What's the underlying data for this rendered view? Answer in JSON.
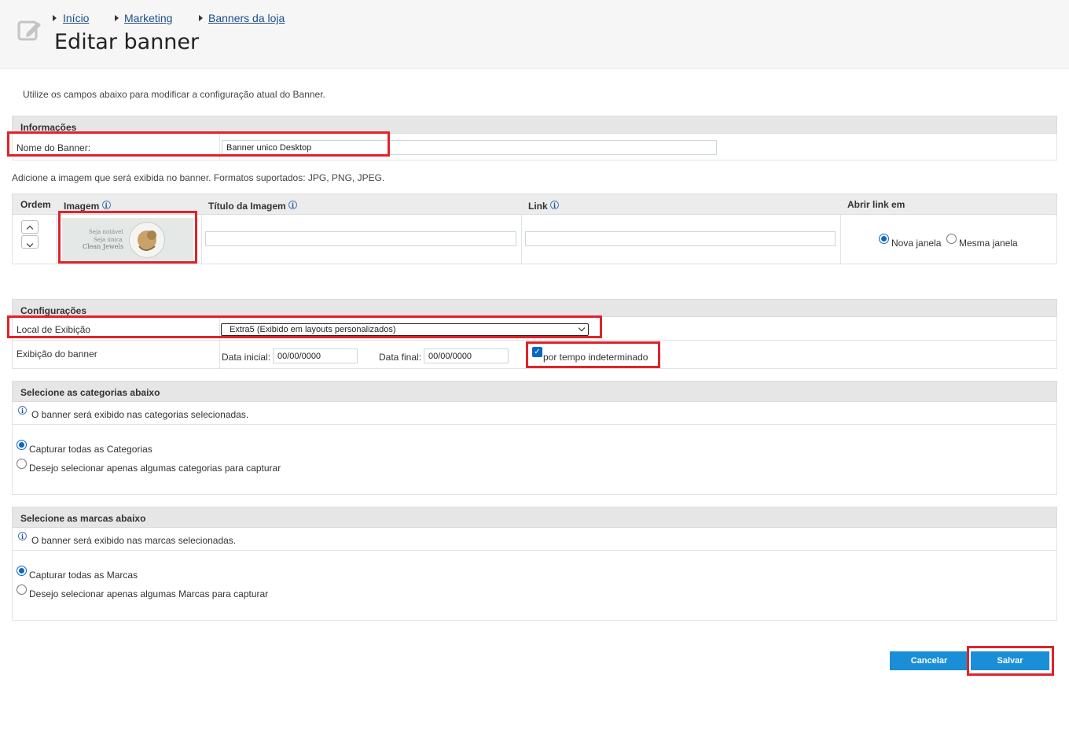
{
  "breadcrumb": [
    "Início",
    "Marketing",
    "Banners da loja"
  ],
  "page_title": "Editar banner",
  "intro": "Utilize os campos abaixo para modificar a configuração atual do Banner.",
  "info_section": {
    "title": "Informações",
    "name_label": "Nome do Banner:",
    "name_value": "Banner unico Desktop"
  },
  "image_hint": "Adicione a imagem que será exibida no banner. Formatos suportados: JPG, PNG, JPEG.",
  "image_table": {
    "col_order": "Ordem",
    "col_image": "Imagem",
    "col_title": "Título da Imagem",
    "col_link": "Link",
    "col_open": "Abrir link em",
    "thumb_text": [
      "Seja notável",
      "Seja única",
      "Clean Jewels"
    ],
    "title_value": "",
    "link_value": "",
    "open_new": "Nova janela",
    "open_same": "Mesma janela",
    "open_selected": "Nova janela"
  },
  "config_section": {
    "title": "Configurações",
    "location_label": "Local de Exibição",
    "location_value": "Extra5 (Exibido em layouts personalizados)",
    "display_label": "Exibição do banner",
    "start_label": "Data inicial:",
    "start_value": "00/00/0000",
    "end_label": "Data final:",
    "end_value": "00/00/0000",
    "indefinite_label": "por tempo indeterminado",
    "indefinite_checked": true
  },
  "categories_section": {
    "title": "Selecione as categorias abaixo",
    "info": "O banner será exibido nas categorias selecionadas.",
    "opt_all": "Capturar todas as Categorias",
    "opt_some": "Desejo selecionar apenas algumas categorias para capturar",
    "selected": "all"
  },
  "brands_section": {
    "title": "Selecione as marcas abaixo",
    "info": "O banner será exibido nas marcas selecionadas.",
    "opt_all": "Capturar todas as Marcas",
    "opt_some": "Desejo selecionar apenas algumas Marcas para capturar",
    "selected": "all"
  },
  "actions": {
    "cancel": "Cancelar",
    "save": "Salvar"
  },
  "colors": {
    "accent": "#1a8fd8",
    "highlight": "#e0232b",
    "link": "#1b4f8a"
  },
  "info_glyph": "i"
}
